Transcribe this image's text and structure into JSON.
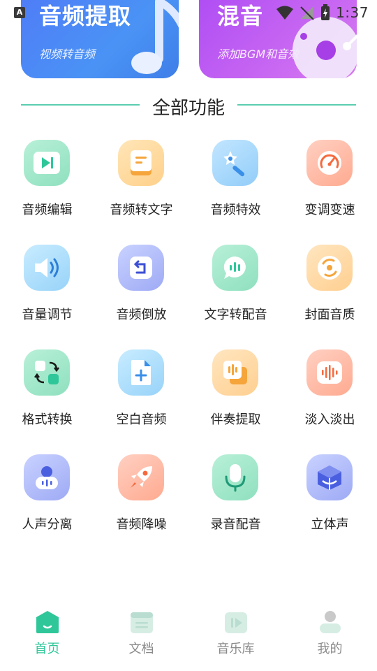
{
  "status_bar": {
    "badge": "A",
    "time": "1:37"
  },
  "banners": [
    {
      "title": "音频提取",
      "subtitle": "视频转音频"
    },
    {
      "title": "混音",
      "subtitle": "添加BGM和音效"
    }
  ],
  "section": {
    "title": "全部功能"
  },
  "features": [
    {
      "label": "音频编辑",
      "icon": "play-box-icon"
    },
    {
      "label": "音频转文字",
      "icon": "document-icon"
    },
    {
      "label": "音频特效",
      "icon": "magic-wand-icon"
    },
    {
      "label": "变调变速",
      "icon": "speedometer-icon"
    },
    {
      "label": "音量调节",
      "icon": "speaker-icon"
    },
    {
      "label": "音频倒放",
      "icon": "rewind-icon"
    },
    {
      "label": "文字转配音",
      "icon": "speech-bubble-icon"
    },
    {
      "label": "封面音质",
      "icon": "disc-icon"
    },
    {
      "label": "格式转换",
      "icon": "convert-icon"
    },
    {
      "label": "空白音频",
      "icon": "new-file-icon"
    },
    {
      "label": "伴奏提取",
      "icon": "waveform-card-icon"
    },
    {
      "label": "淡入淡出",
      "icon": "waveform-icon"
    },
    {
      "label": "人声分离",
      "icon": "voice-separation-icon"
    },
    {
      "label": "音频降噪",
      "icon": "rocket-icon"
    },
    {
      "label": "录音配音",
      "icon": "microphone-icon"
    },
    {
      "label": "立体声",
      "icon": "cube-icon"
    }
  ],
  "nav": [
    {
      "label": "首页",
      "icon": "home-icon",
      "active": true
    },
    {
      "label": "文档",
      "icon": "document-list-icon",
      "active": false
    },
    {
      "label": "音乐库",
      "icon": "music-library-icon",
      "active": false
    },
    {
      "label": "我的",
      "icon": "user-icon",
      "active": false
    }
  ],
  "colors": {
    "accent": "#2fc79a",
    "section_line": "#5bcdb0",
    "nav_inactive": "#8a8a8a"
  }
}
